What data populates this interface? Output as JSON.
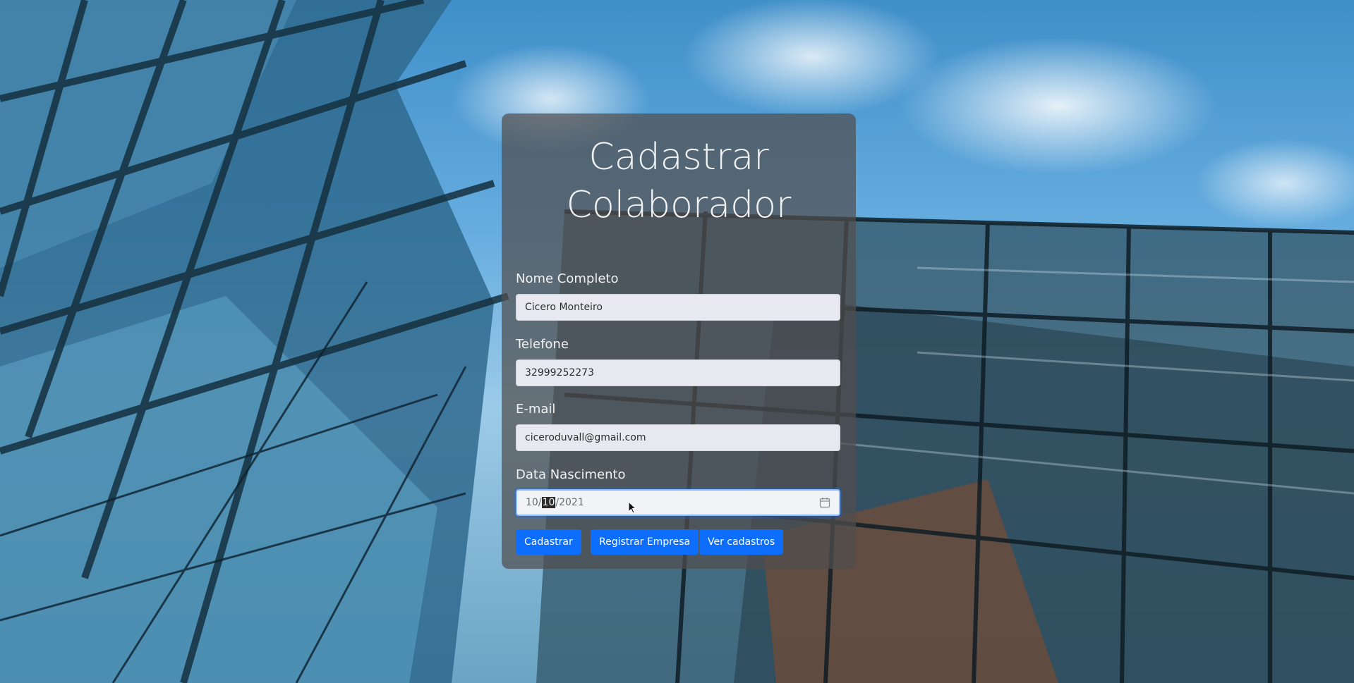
{
  "form": {
    "title_line1": "Cadastrar",
    "title_line2": "Colaborador",
    "fields": [
      {
        "label": "Nome Completo",
        "value": "Cicero Monteiro"
      },
      {
        "label": "Telefone",
        "value": "32999252273"
      },
      {
        "label": "E-mail",
        "value": "ciceroduvall@gmail.com"
      },
      {
        "label": "Data Nascimento",
        "day": "10",
        "month": "10",
        "year": "2021"
      }
    ],
    "buttons": {
      "submit": "Cadastrar",
      "register_company": "Registrar Empresa",
      "view_records": "Ver cadastros"
    }
  },
  "colors": {
    "button": "#0d6efd",
    "card": "rgba(80,78,78,0.72)"
  },
  "icons": {
    "date": "calendar-icon"
  }
}
